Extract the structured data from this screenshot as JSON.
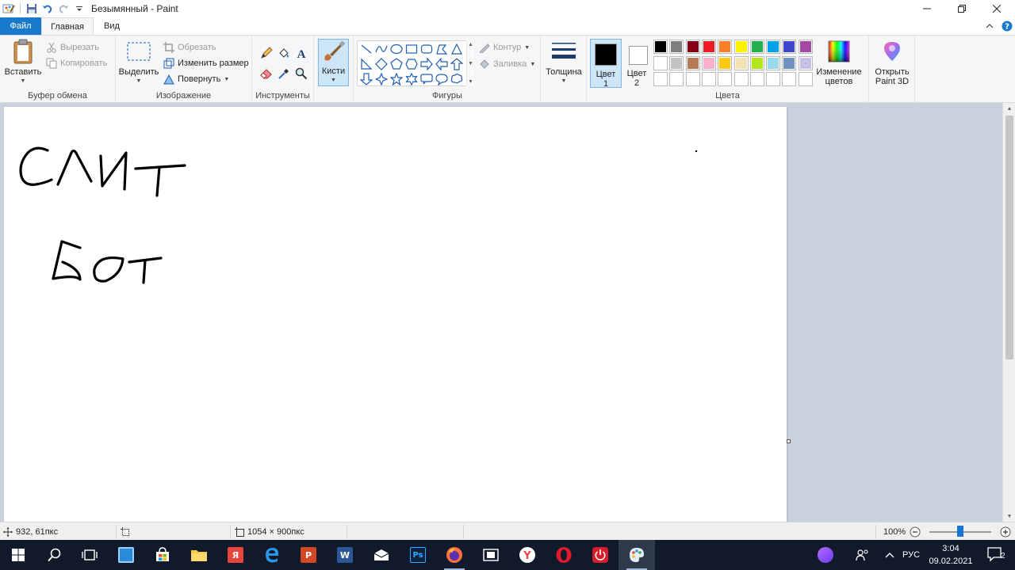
{
  "window": {
    "title": "Безымянный - Paint",
    "controls": [
      "minimize",
      "restore",
      "close"
    ]
  },
  "tabs": {
    "file": "Файл",
    "home": "Главная",
    "view": "Вид"
  },
  "ribbon": {
    "clipboard": {
      "group_label": "Буфер обмена",
      "paste": "Вставить",
      "cut": "Вырезать",
      "copy": "Копировать"
    },
    "image": {
      "group_label": "Изображение",
      "select": "Выделить",
      "crop": "Обрезать",
      "resize": "Изменить размер",
      "rotate": "Повернуть"
    },
    "tools": {
      "group_label": "Инструменты",
      "items": [
        "pencil-icon",
        "fill-icon",
        "text-icon",
        "eraser-icon",
        "color-picker-icon",
        "magnifier-icon"
      ]
    },
    "brushes": {
      "label": "Кисти"
    },
    "shapes": {
      "group_label": "Фигуры",
      "outline": "Контур",
      "fill": "Заливка"
    },
    "size": {
      "label": "Толщина"
    },
    "colors": {
      "group_label": "Цвета",
      "color1_line1": "Цвет",
      "color1_line2": "1",
      "color2_line1": "Цвет",
      "color2_line2": "2",
      "color1_value": "#000000",
      "color2_value": "#ffffff",
      "edit_line1": "Изменение",
      "edit_line2": "цветов",
      "palette_row1": [
        "#000000",
        "#7f7f7f",
        "#880015",
        "#ed1c24",
        "#ff7f27",
        "#fff200",
        "#22b14c",
        "#00a2e8",
        "#3f48cc",
        "#a349a4"
      ],
      "palette_row2": [
        "#ffffff",
        "#c3c3c3",
        "#b97a57",
        "#ffaec9",
        "#ffc90e",
        "#efe4b0",
        "#b5e61d",
        "#99d9ea",
        "#7092be",
        "#c8bfe7"
      ]
    },
    "paint3d": {
      "line1": "Открыть",
      "line2": "Paint 3D"
    }
  },
  "canvas": {
    "handwriting_line1": "СЛИТ",
    "handwriting_line2": "БОТ"
  },
  "statusbar": {
    "cursor_pos": "932, 61пкс",
    "canvas_size": "1054 × 900пкс",
    "zoom": "100%"
  },
  "taskbar": {
    "apps": [
      "start",
      "search",
      "task-view",
      "store-app",
      "microsoft-store",
      "file-explorer",
      "yandex-browser-app",
      "edge",
      "powerpoint",
      "word",
      "mail",
      "photoshop",
      "firefox",
      "movies-app",
      "yandex",
      "opera",
      "power-app",
      "paint"
    ],
    "lang": "РУС",
    "time": "3:04",
    "date": "09.02.2021",
    "notifications": "2"
  }
}
